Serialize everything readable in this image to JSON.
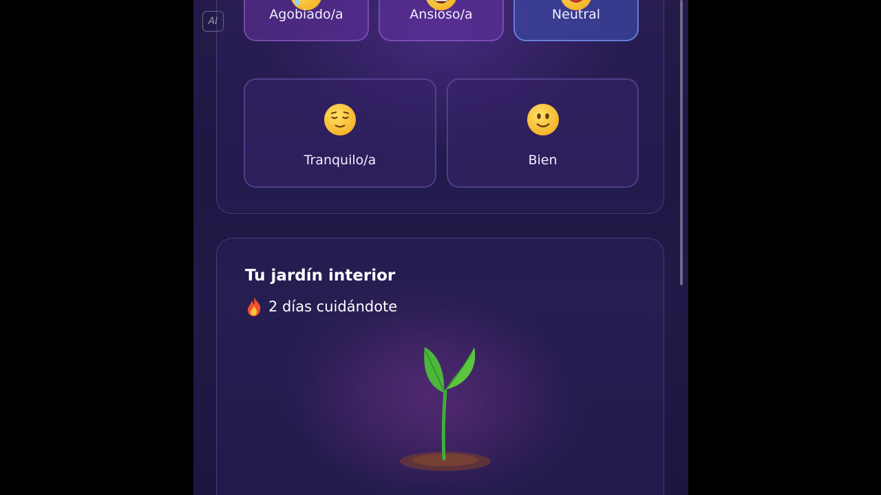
{
  "app": {
    "badge": "AI",
    "moods": [
      {
        "label": "Agobiado/a",
        "icon": "anxious-sweat-face-icon",
        "state": "default"
      },
      {
        "label": "Ansioso/a",
        "icon": "grimacing-face-icon",
        "state": "default"
      },
      {
        "label": "Neutral",
        "icon": "neutral-face-icon",
        "state": "selected"
      },
      {
        "label": "Tranquilo/a",
        "icon": "relieved-face-icon",
        "state": "default"
      },
      {
        "label": "Bien",
        "icon": "slightly-smiling-face-icon",
        "state": "default"
      }
    ],
    "garden": {
      "title": "Tu jardín interior",
      "streak": "2 días cuidándote",
      "streak_icon": "fire-icon",
      "plant_icon": "sprout-icon"
    }
  },
  "colors": {
    "background": "#1d1844",
    "selected_card": "#3c46a0",
    "accent_purple": "#6432a0"
  }
}
